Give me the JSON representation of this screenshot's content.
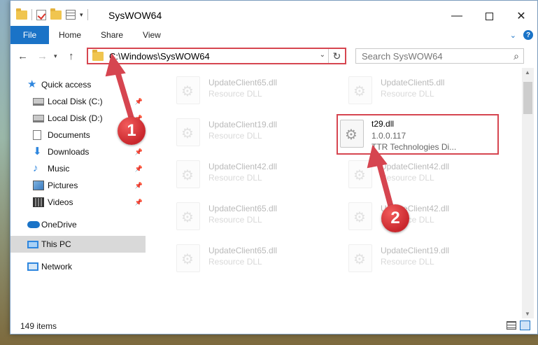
{
  "window": {
    "title": "SysWOW64",
    "min_glyph": "—",
    "close_glyph": "✕"
  },
  "ribbon": {
    "tabs": [
      "File",
      "Home",
      "Share",
      "View"
    ],
    "expand_glyph": "⌄",
    "help_glyph": "?"
  },
  "nav": {
    "back_glyph": "←",
    "forward_glyph": "→",
    "recent_glyph": "▾",
    "up_glyph": "↑",
    "address": "C:\\Windows\\SysWOW64",
    "dropdown_glyph": "⌄",
    "refresh_glyph": "↻",
    "search_placeholder": "Search SysWOW64",
    "search_glyph": "⌕"
  },
  "sidebar": {
    "items": [
      {
        "label": "Quick access",
        "icon": "star-icon",
        "pinned": false
      },
      {
        "label": "Local Disk (C:)",
        "icon": "disk-icon",
        "pinned": true
      },
      {
        "label": "Local Disk (D:)",
        "icon": "disk-icon",
        "pinned": true
      },
      {
        "label": "Documents",
        "icon": "documents-icon",
        "pinned": true
      },
      {
        "label": "Downloads",
        "icon": "downloads-icon",
        "pinned": true
      },
      {
        "label": "Music",
        "icon": "music-icon",
        "pinned": true
      },
      {
        "label": "Pictures",
        "icon": "pictures-icon",
        "pinned": true
      },
      {
        "label": "Videos",
        "icon": "videos-icon",
        "pinned": true
      },
      {
        "label": "OneDrive",
        "icon": "onedrive-icon",
        "pinned": false
      },
      {
        "label": "This PC",
        "icon": "this-pc-icon",
        "pinned": false,
        "selected": true
      },
      {
        "label": "Network",
        "icon": "network-icon",
        "pinned": false
      }
    ],
    "pin_glyph": "📌",
    "star_glyph": "★",
    "download_glyph": "⬇",
    "music_glyph": "♪"
  },
  "files": {
    "left": [
      {
        "name": "UpdateClient65.dll",
        "desc": "Resource DLL"
      },
      {
        "name": "UpdateClient19.dll",
        "desc": "Resource DLL"
      },
      {
        "name": "UpdateClient42.dll",
        "desc": "Resource DLL"
      },
      {
        "name": "UpdateClient65.dll",
        "desc": "Resource DLL"
      },
      {
        "name": "UpdateClient65.dll",
        "desc": "Resource DLL"
      }
    ],
    "right": [
      {
        "name": "UpdateClient5.dll",
        "desc": "Resource DLL"
      },
      {
        "name": "t29.dll",
        "version": "1.0.0.117",
        "company": "TTR Technologies Di...",
        "highlight": true
      },
      {
        "name": "UpdateClient42.dll",
        "desc": "Resource DLL"
      },
      {
        "name": "UpdateClient42.dll",
        "desc": "Resource DLL"
      },
      {
        "name": "UpdateClient19.dll",
        "desc": "Resource DLL"
      }
    ]
  },
  "status": {
    "item_count": "149 items"
  },
  "annotations": {
    "callout_1": "1",
    "callout_2": "2",
    "color": "#d64550"
  }
}
